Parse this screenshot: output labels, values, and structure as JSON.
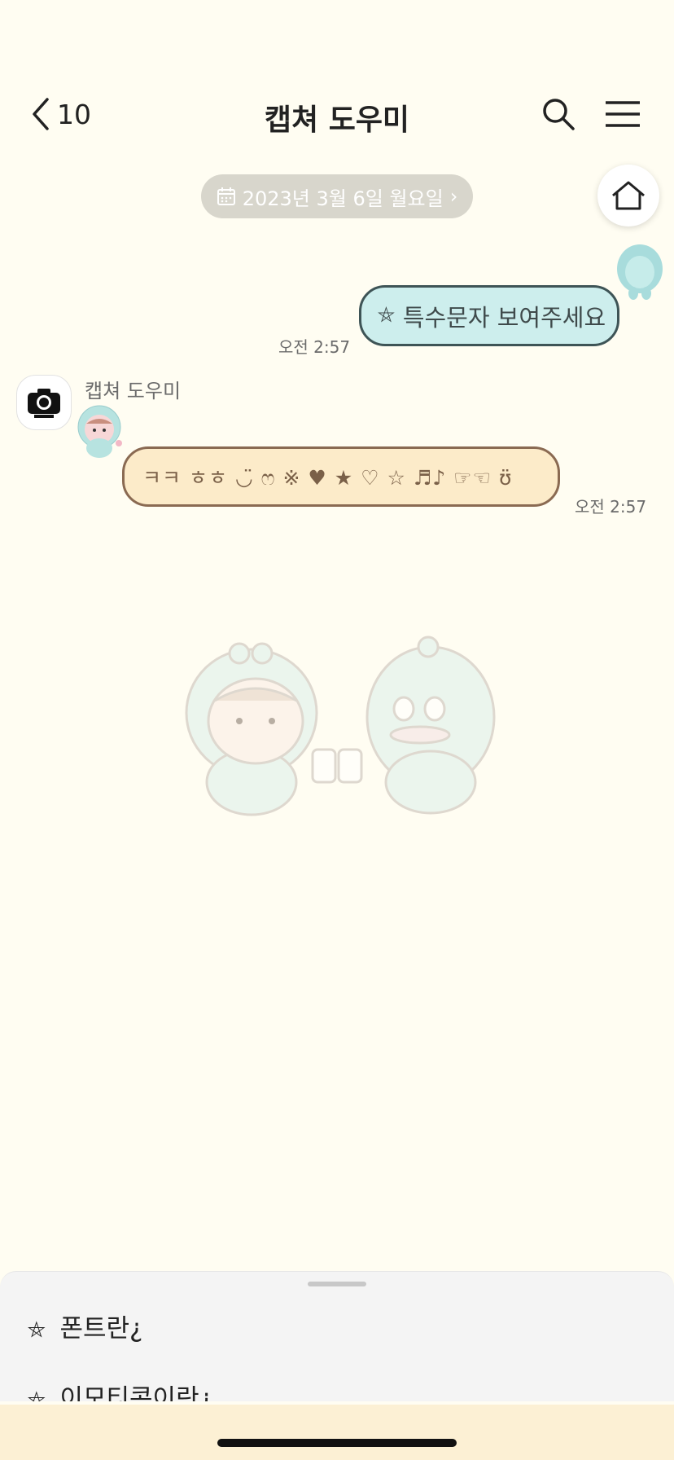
{
  "header": {
    "back_count": "10",
    "title": "캡쳐 도우미",
    "icons": [
      "chevron-left-icon",
      "search-icon",
      "hamburger-menu-icon"
    ]
  },
  "home_button": {
    "icon": "home-icon"
  },
  "date_divider": {
    "icon": "calendar-icon",
    "label": "2023년 3월 6일 월요일",
    "chevron": "›"
  },
  "messages": [
    {
      "sender": "me",
      "icon_glyph": "⛤",
      "text": "특수문자 보여주세요",
      "time": "오전 2:57"
    },
    {
      "sender": "bot",
      "sender_name": "캡쳐 도우미",
      "text": "ㅋㅋ ㅎㅎ ◡̈ ෆ ※ ♥ ★ ♡ ☆ ♬♪ ☞☜ ʊ̈",
      "time": "오전 2:57"
    }
  ],
  "bottom_sheet": {
    "items": [
      {
        "icon_glyph": "⛤",
        "label": "폰트란¿"
      },
      {
        "icon_glyph": "⛤",
        "label": "이모티콘이란¿"
      }
    ]
  },
  "colors": {
    "background": "#fffdf2",
    "my_bubble": "#cdeeed",
    "bot_bubble": "#fcebc9",
    "date_pill": "#d8d6cc"
  }
}
